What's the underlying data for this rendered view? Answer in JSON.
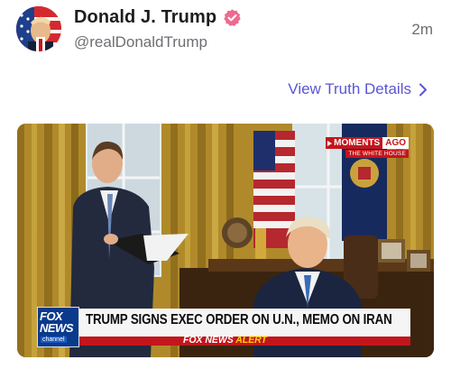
{
  "post": {
    "display_name": "Donald J. Trump",
    "handle": "@realDonaldTrump",
    "time": "2m",
    "details_link": "View Truth Details",
    "verified_color": "#ee6a8f",
    "accent_color": "#5a55d6"
  },
  "media": {
    "moments_label": "MOMENTS",
    "ago_label": "AGO",
    "source_label": "THE WHITE HOUSE",
    "fox_logo_line1": "FOX",
    "fox_logo_line2": "NEWS",
    "fox_logo_line3": "channel",
    "headline": "TRUMP SIGNS EXEC ORDER ON U.N., MEMO ON IRAN",
    "alert_brand": "FOX NEWS",
    "alert_label": "ALERT"
  },
  "icons": {
    "verified": "verified-badge-icon",
    "chevron": "chevron-right-icon"
  }
}
